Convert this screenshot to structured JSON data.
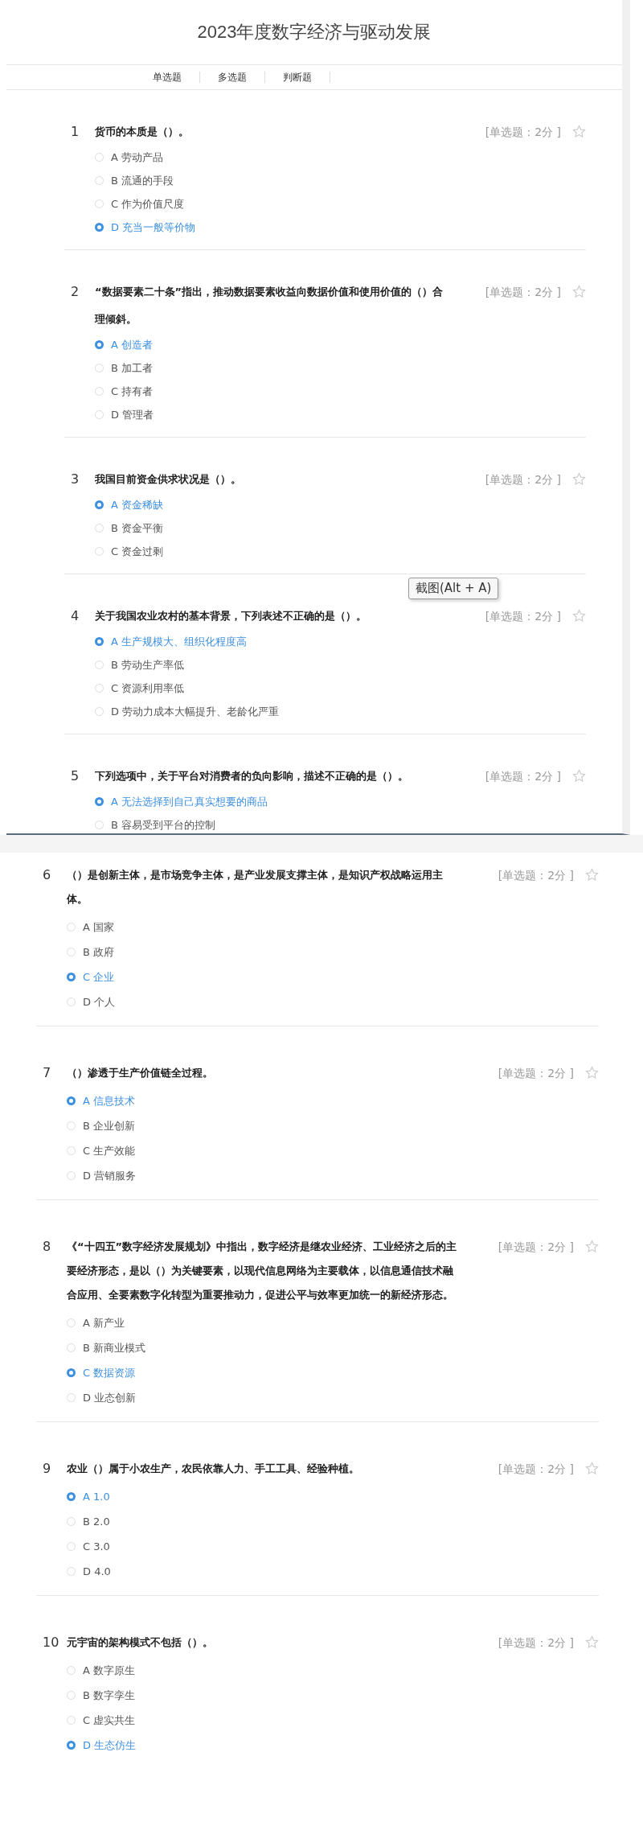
{
  "header": {
    "title": "2023年度数字经济与驱动发展"
  },
  "tabs": [
    {
      "label": "单选题"
    },
    {
      "label": "多选题"
    },
    {
      "label": "判断题"
    }
  ],
  "tooltip": {
    "text": "截图(Alt + A)"
  },
  "panels": [
    {
      "questions": [
        {
          "number": "1",
          "text": "货币的本质是（）。",
          "score": "[单选题：2分 ]",
          "options": [
            {
              "label": "A",
              "text": "劳动产品",
              "selected": false
            },
            {
              "label": "B",
              "text": "流通的手段",
              "selected": false
            },
            {
              "label": "C",
              "text": "作为价值尺度",
              "selected": false
            },
            {
              "label": "D",
              "text": "充当一般等价物",
              "selected": true
            }
          ]
        },
        {
          "number": "2",
          "text": "“数据要素二十条”指出，推动数据要素收益向数据价值和使用价值的（）合理倾斜。",
          "score": "[单选题：2分 ]",
          "options": [
            {
              "label": "A",
              "text": "创造者",
              "selected": true
            },
            {
              "label": "B",
              "text": "加工者",
              "selected": false
            },
            {
              "label": "C",
              "text": "持有者",
              "selected": false
            },
            {
              "label": "D",
              "text": "管理者",
              "selected": false
            }
          ]
        },
        {
          "number": "3",
          "text": "我国目前资金供求状况是（）。",
          "score": "[单选题：2分 ]",
          "options": [
            {
              "label": "A",
              "text": "资金稀缺",
              "selected": true
            },
            {
              "label": "B",
              "text": "资金平衡",
              "selected": false
            },
            {
              "label": "C",
              "text": "资金过剩",
              "selected": false
            }
          ]
        },
        {
          "number": "4",
          "text": "关于我国农业农村的基本背景，下列表述不正确的是（）。",
          "score": "[单选题：2分 ]",
          "options": [
            {
              "label": "A",
              "text": "生产规模大、组织化程度高",
              "selected": true
            },
            {
              "label": "B",
              "text": "劳动生产率低",
              "selected": false
            },
            {
              "label": "C",
              "text": "资源利用率低",
              "selected": false
            },
            {
              "label": "D",
              "text": "劳动力成本大幅提升、老龄化严重",
              "selected": false
            }
          ]
        },
        {
          "number": "5",
          "text": "下列选项中，关于平台对消费者的负向影响，描述不正确的是（）。",
          "score": "[单选题：2分 ]",
          "options": [
            {
              "label": "A",
              "text": "无法选择到自己真实想要的商品",
              "selected": true
            },
            {
              "label": "B",
              "text": "容易受到平台的控制",
              "selected": false
            }
          ]
        }
      ]
    },
    {
      "questions": [
        {
          "number": "6",
          "text": "（）是创新主体，是市场竞争主体，是产业发展支撑主体，是知识产权战略运用主体。",
          "score": "[单选题：2分 ]",
          "options": [
            {
              "label": "A",
              "text": "国家",
              "selected": false
            },
            {
              "label": "B",
              "text": "政府",
              "selected": false
            },
            {
              "label": "C",
              "text": "企业",
              "selected": true
            },
            {
              "label": "D",
              "text": "个人",
              "selected": false
            }
          ]
        },
        {
          "number": "7",
          "text": "（）渗透于生产价值链全过程。",
          "score": "[单选题：2分 ]",
          "options": [
            {
              "label": "A",
              "text": "信息技术",
              "selected": true
            },
            {
              "label": "B",
              "text": "企业创新",
              "selected": false
            },
            {
              "label": "C",
              "text": "生产效能",
              "selected": false
            },
            {
              "label": "D",
              "text": "营销服务",
              "selected": false
            }
          ]
        },
        {
          "number": "8",
          "text": "《“十四五”数字经济发展规划》中指出，数字经济是继农业经济、工业经济之后的主要经济形态，是以（）为关键要素，以现代信息网络为主要载体，以信息通信技术融合应用、全要素数字化转型为重要推动力，促进公平与效率更加统一的新经济形态。",
          "score": "[单选题：2分 ]",
          "options": [
            {
              "label": "A",
              "text": "新产业",
              "selected": false
            },
            {
              "label": "B",
              "text": "新商业模式",
              "selected": false
            },
            {
              "label": "C",
              "text": "数据资源",
              "selected": true
            },
            {
              "label": "D",
              "text": "业态创新",
              "selected": false
            }
          ]
        },
        {
          "number": "9",
          "text": "农业（）属于小农生产，农民依靠人力、手工工具、经验种植。",
          "score": "[单选题：2分 ]",
          "options": [
            {
              "label": "A",
              "text": "1.0",
              "selected": true
            },
            {
              "label": "B",
              "text": "2.0",
              "selected": false
            },
            {
              "label": "C",
              "text": "3.0",
              "selected": false
            },
            {
              "label": "D",
              "text": "4.0",
              "selected": false
            }
          ]
        },
        {
          "number": "10",
          "text": "元宇宙的架构模式不包括（）。",
          "score": "[单选题：2分 ]",
          "options": [
            {
              "label": "A",
              "text": "数字原生",
              "selected": false
            },
            {
              "label": "B",
              "text": "数字孪生",
              "selected": false
            },
            {
              "label": "C",
              "text": "虚实共生",
              "selected": false
            },
            {
              "label": "D",
              "text": "生态仿生",
              "selected": true
            }
          ]
        }
      ]
    }
  ]
}
